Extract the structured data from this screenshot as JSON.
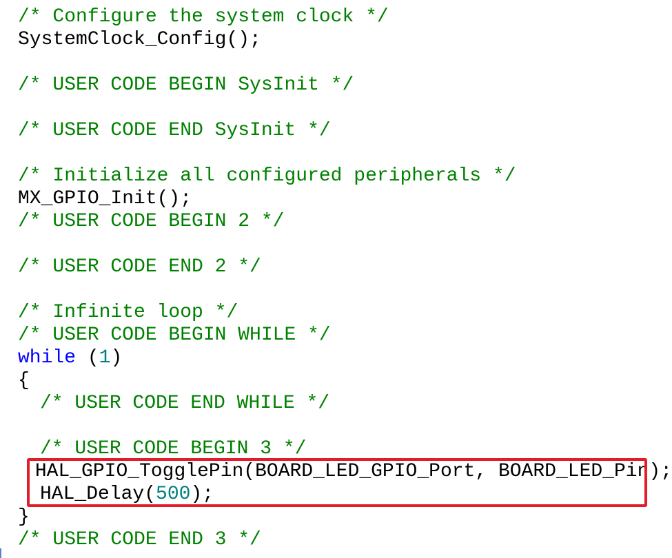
{
  "editor": {
    "highlight_color": "#e11d2a",
    "lines": [
      {
        "indent": 0,
        "tokens": [
          {
            "type": "comment",
            "text": "/* Configure the system clock */"
          }
        ]
      },
      {
        "indent": 0,
        "tokens": [
          {
            "type": "code",
            "text": "SystemClock_Config();"
          }
        ]
      },
      {
        "indent": 0,
        "tokens": []
      },
      {
        "indent": 0,
        "tokens": [
          {
            "type": "comment",
            "text": "/* USER CODE BEGIN SysInit */"
          }
        ]
      },
      {
        "indent": 0,
        "tokens": []
      },
      {
        "indent": 0,
        "tokens": [
          {
            "type": "comment",
            "text": "/* USER CODE END SysInit */"
          }
        ]
      },
      {
        "indent": 0,
        "tokens": []
      },
      {
        "indent": 0,
        "tokens": [
          {
            "type": "comment",
            "text": "/* Initialize all configured peripherals */"
          }
        ]
      },
      {
        "indent": 0,
        "tokens": [
          {
            "type": "code",
            "text": "MX_GPIO_Init();"
          }
        ]
      },
      {
        "indent": 0,
        "tokens": [
          {
            "type": "comment",
            "text": "/* USER CODE BEGIN 2 */"
          }
        ]
      },
      {
        "indent": 0,
        "tokens": []
      },
      {
        "indent": 0,
        "tokens": [
          {
            "type": "comment",
            "text": "/* USER CODE END 2 */"
          }
        ]
      },
      {
        "indent": 0,
        "tokens": []
      },
      {
        "indent": 0,
        "tokens": [
          {
            "type": "comment",
            "text": "/* Infinite loop */"
          }
        ]
      },
      {
        "indent": 0,
        "tokens": [
          {
            "type": "comment",
            "text": "/* USER CODE BEGIN WHILE */"
          }
        ]
      },
      {
        "indent": 0,
        "tokens": [
          {
            "type": "keyword",
            "text": "while"
          },
          {
            "type": "code",
            "text": " ("
          },
          {
            "type": "number",
            "text": "1"
          },
          {
            "type": "code",
            "text": ")"
          }
        ]
      },
      {
        "indent": 0,
        "tokens": [
          {
            "type": "code",
            "text": "{"
          }
        ]
      },
      {
        "indent": 1,
        "tokens": [
          {
            "type": "comment",
            "text": "/* USER CODE END WHILE */"
          }
        ]
      },
      {
        "indent": 0,
        "tokens": []
      },
      {
        "indent": 1,
        "tokens": [
          {
            "type": "comment",
            "text": "/* USER CODE BEGIN 3 */"
          }
        ]
      },
      {
        "indent": 1,
        "tokens": [
          {
            "type": "code",
            "text": "HAL_GPIO_TogglePin(BOARD_LED_GPIO_Port, BOARD_LED_Pin);"
          }
        ]
      },
      {
        "indent": 1,
        "tokens": [
          {
            "type": "code",
            "text": "HAL_Delay("
          },
          {
            "type": "number",
            "text": "500"
          },
          {
            "type": "code",
            "text": ");"
          }
        ]
      },
      {
        "indent": 0,
        "tokens": [
          {
            "type": "code",
            "text": "}"
          }
        ]
      },
      {
        "indent": 0,
        "tokens": [
          {
            "type": "comment",
            "text": "/* USER CODE END 3 */"
          }
        ]
      }
    ]
  }
}
